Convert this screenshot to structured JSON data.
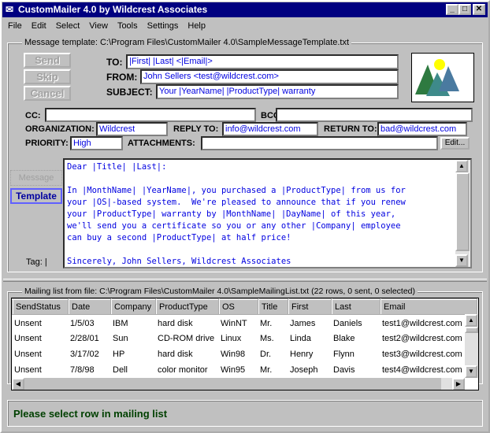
{
  "window": {
    "title": "CustomMailer 4.0 by Wildcrest Associates"
  },
  "menu": [
    "File",
    "Edit",
    "Select",
    "View",
    "Tools",
    "Settings",
    "Help"
  ],
  "template": {
    "legend": "Message template: C:\\Program Files\\CustomMailer 4.0\\SampleMessageTemplate.txt",
    "buttons": {
      "send": "Send",
      "skip": "Skip",
      "cancel": "Cancel",
      "edit": "Edit...",
      "message": "Message",
      "template": "Template"
    },
    "labels": {
      "to": "TO:",
      "from": "FROM:",
      "subject": "SUBJECT:",
      "cc": "CC:",
      "bcc": "BCC:",
      "organization": "ORGANIZATION:",
      "reply_to": "REPLY TO:",
      "return_to": "RETURN TO:",
      "priority": "PRIORITY:",
      "attachments": "ATTACHMENTS:",
      "tag": "Tag: |"
    },
    "values": {
      "to": "|First| |Last| <|Email|>",
      "from": "John Sellers <test@wildcrest.com>",
      "subject": "Your |YearName| |ProductType| warranty",
      "cc": "",
      "bcc": "",
      "organization": "Wildcrest",
      "reply_to": "info@wildcrest.com",
      "return_to": "bad@wildcrest.com",
      "priority": "High",
      "attachments": ""
    },
    "body": "Dear |Title| |Last|:\n\nIn |MonthName| |YearName|, you purchased a |ProductType| from us for\nyour |OS|-based system.  We're pleased to announce that if you renew\nyour |ProductType| warranty by |MonthName| |DayName| of this year,\nwe'll send you a certificate so you or any other |Company| employee\ncan buy a second |ProductType| at half price!\n\nSincerely, John Sellers, Wildcrest Associates"
  },
  "mailing": {
    "legend": "Mailing list from file: C:\\Program Files\\CustomMailer 4.0\\SampleMailingList.txt (22 rows, 0 sent, 0 selected)",
    "columns": [
      "SendStatus",
      "Date",
      "Company",
      "ProductType",
      "OS",
      "Title",
      "First",
      "Last",
      "Email"
    ],
    "rows": [
      [
        "Unsent",
        "1/5/03",
        "IBM",
        "hard disk",
        "WinNT",
        "Mr.",
        "James",
        "Daniels",
        "test1@wildcrest.com"
      ],
      [
        "Unsent",
        "2/28/01",
        "Sun",
        "CD-ROM drive",
        "Linux",
        "Ms.",
        "Linda",
        "Blake",
        "test2@wildcrest.com"
      ],
      [
        "Unsent",
        "3/17/02",
        "HP",
        "hard disk",
        "Win98",
        "Dr.",
        "Henry",
        "Flynn",
        "test3@wildcrest.com"
      ],
      [
        "Unsent",
        "7/8/98",
        "Dell",
        "color monitor",
        "Win95",
        "Mr.",
        "Joseph",
        "Davis",
        "test4@wildcrest.com"
      ]
    ]
  },
  "status": {
    "text": "Please select row in mailing list",
    "color": "#004000"
  }
}
